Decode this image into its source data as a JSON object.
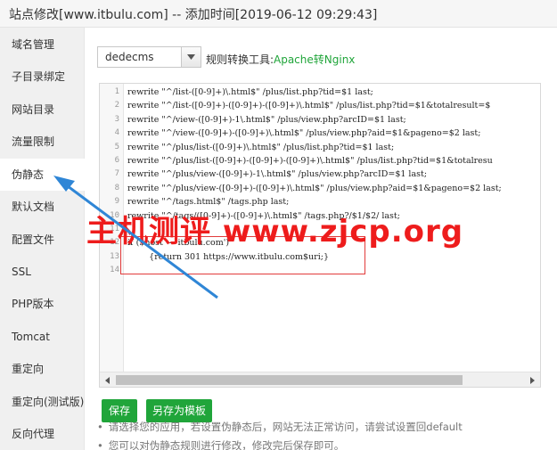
{
  "window": {
    "title": "站点修改[www.itbulu.com] -- 添加时间[2019-06-12 09:29:43]"
  },
  "sidebar": {
    "items": [
      {
        "label": "域名管理"
      },
      {
        "label": "子目录绑定"
      },
      {
        "label": "网站目录"
      },
      {
        "label": "流量限制"
      },
      {
        "label": "伪静态",
        "active": true
      },
      {
        "label": "默认文档"
      },
      {
        "label": "配置文件"
      },
      {
        "label": "SSL"
      },
      {
        "label": "PHP版本"
      },
      {
        "label": "Tomcat"
      },
      {
        "label": "重定向"
      },
      {
        "label": "重定向(测试版)"
      },
      {
        "label": "反向代理"
      }
    ]
  },
  "toolbar": {
    "rule_select_value": "dedecms",
    "tool_label": "规则转换工具:",
    "tool_link": "Apache转Nginx"
  },
  "editor": {
    "line_numbers": [
      "1",
      "2",
      "3",
      "4",
      "5",
      "6",
      "7",
      "8",
      "9",
      "10",
      "11",
      "12",
      "13",
      "14"
    ],
    "lines": [
      "rewrite \"^/list-([0-9]+)\\.html$\" /plus/list.php?tid=$1 last;",
      "rewrite \"^/list-([0-9]+)-([0-9]+)-([0-9]+)\\.html$\" /plus/list.php?tid=$1&totalresult=$",
      "rewrite \"^/view-([0-9]+)-1\\.html$\" /plus/view.php?arcID=$1 last;",
      "rewrite \"^/view-([0-9]+)-([0-9]+)\\.html$\" /plus/view.php?aid=$1&pageno=$2 last;",
      "rewrite \"^/plus/list-([0-9]+)\\.html$\" /plus/list.php?tid=$1 last;",
      "rewrite \"^/plus/list-([0-9]+)-([0-9]+)-([0-9]+)\\.html$\" /plus/list.php?tid=$1&totalresu",
      "rewrite \"^/plus/view-([0-9]+)-1\\.html$\" /plus/view.php?arcID=$1 last;",
      "rewrite \"^/plus/view-([0-9]+)-([0-9]+)\\.html$\" /plus/view.php?aid=$1&pageno=$2 last;",
      "rewrite \"^/tags.html$\" /tags.php last;",
      "rewrite \"^/tags/([0-9]+)-([0-9]+)\\.html$\" /tags.php?/$1/$2/ last;",
      "",
      "if ($host ~ 'itbulu.com')",
      "        {return 301 https://www.itbulu.com$uri;}",
      ""
    ]
  },
  "buttons": {
    "save": "保存",
    "save_as_template": "另存为模板"
  },
  "tips": [
    "请选择您的应用，若设置伪静态后，网站无法正常访问，请尝试设置回default",
    "您可以对伪静态规则进行修改，修改完后保存即可。"
  ],
  "watermark": "主机测评 www.zjcp.org",
  "colors": {
    "accent_green": "#20a53a",
    "annotation_red": "#e23b3b",
    "arrow_blue": "#2f86d6"
  }
}
